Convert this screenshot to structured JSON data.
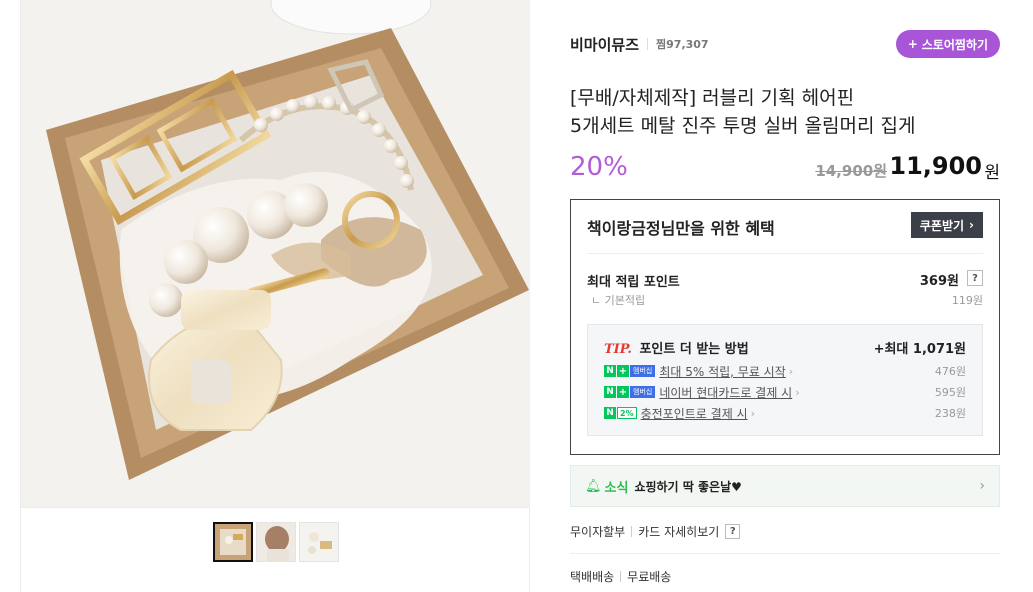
{
  "store": {
    "name": "비마이뮤즈",
    "fav_count": "찜97,307",
    "fav_button": "스토어찜하기",
    "fav_button_icon": "plus-icon"
  },
  "product": {
    "title_line1": "[무배/자체제작] 러블리 기획 헤어핀",
    "title_line2": "5개세트 메탈 진주 투명 실버 올림머리 집게",
    "discount": "20%",
    "original_price": "14,900원",
    "sale_price": "11,900",
    "currency": "원"
  },
  "benefits": {
    "title": "책이랑금정님만을 위한 혜택",
    "coupon_button": "쿠폰받기",
    "max_points_label": "최대 적립 포인트",
    "max_points_value": "369원",
    "basic_label": "ㄴ 기본적립",
    "basic_value": "119원",
    "tip_mark": "TIP.",
    "tip_title": "포인트 더 받는 방법",
    "tip_max": "+최대 1,071원",
    "tips": [
      {
        "badge": "membership",
        "text": "최대 5% 적립, 무료 시작",
        "amount": "476원"
      },
      {
        "badge": "membership",
        "text": "네이버 현대카드로 결제 시",
        "amount": "595원"
      },
      {
        "badge": "two-percent",
        "text": "충전포인트로 결제 시",
        "amount": "238원"
      }
    ],
    "badge_n": "N",
    "badge_plus": "+",
    "badge_membership": "멤버십",
    "badge_pct": "2%"
  },
  "news": {
    "tag": "소식",
    "text": "쇼핑하기 딱 좋은날♥"
  },
  "installment": {
    "label": "무이자할부",
    "card_link": "카드 자세히보기",
    "help": "?"
  },
  "shipping": {
    "type": "택배배송",
    "fee": "무료배송"
  },
  "gallery": {
    "thumbnails": [
      "hair-clips-box",
      "model-updo",
      "clips-flatlay"
    ]
  },
  "colors": {
    "accent_purple": "#a855d8",
    "discount_purple": "#b25cd6",
    "naver_green": "#03c75a",
    "tip_red": "#e53935"
  }
}
